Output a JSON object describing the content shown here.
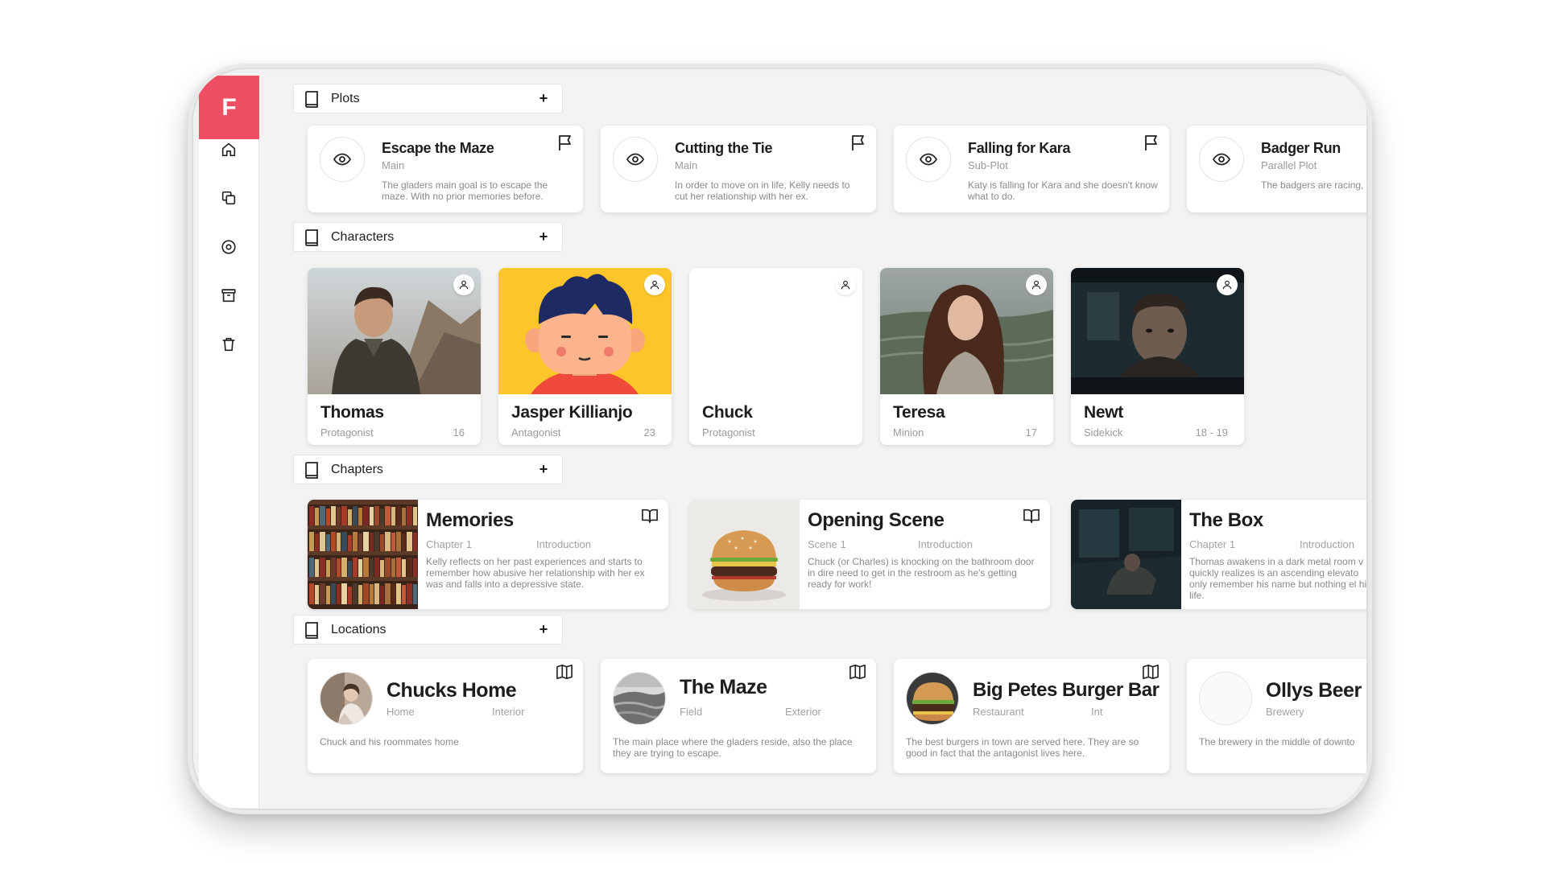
{
  "app": {
    "logo_letter": "F",
    "brand_color": "#ee4f62"
  },
  "sidebar": {
    "items": [
      {
        "icon": "home-icon"
      },
      {
        "icon": "copy-icon"
      },
      {
        "icon": "target-icon"
      },
      {
        "icon": "archive-icon"
      },
      {
        "icon": "trash-icon"
      }
    ]
  },
  "sections": {
    "plots": {
      "title": "Plots",
      "add_label": "+"
    },
    "characters": {
      "title": "Characters",
      "add_label": "+"
    },
    "chapters": {
      "title": "Chapters",
      "add_label": "+"
    },
    "locations": {
      "title": "Locations",
      "add_label": "+"
    }
  },
  "plots": [
    {
      "name": "Escape the Maze",
      "type": "Main",
      "desc": "The gladers main goal is to escape the maze. With no prior memories before."
    },
    {
      "name": "Cutting the Tie",
      "type": "Main",
      "desc": "In order to move on in life, Kelly needs to cut her relationship with her ex."
    },
    {
      "name": "Falling for Kara",
      "type": "Sub-Plot",
      "desc": "Katy is falling for Kara and she doesn't know what to do."
    },
    {
      "name": "Badger Run",
      "type": "Parallel Plot",
      "desc": "The badgers are racing, time that they bunnies a"
    }
  ],
  "characters": [
    {
      "name": "Thomas",
      "role": "Protagonist",
      "age": "16"
    },
    {
      "name": "Jasper Killianjo",
      "role": "Antagonist",
      "age": "23"
    },
    {
      "name": "Chuck",
      "role": "Protagonist",
      "age": ""
    },
    {
      "name": "Teresa",
      "role": "Minion",
      "age": "17"
    },
    {
      "name": "Newt",
      "role": "Sidekick",
      "age": "18 - 19"
    }
  ],
  "chapters": [
    {
      "name": "Memories",
      "num": "Chapter 1",
      "kind": "Introduction",
      "desc": "Kelly reflects on her past experiences and starts to remember how abusive her relationship with her ex was and falls into a depressive state."
    },
    {
      "name": "Opening Scene",
      "num": "Scene 1",
      "kind": "Introduction",
      "desc": "Chuck (or Charles) is knocking on the bathroom door in dire need to get in the restroom as he's getting ready for work!"
    },
    {
      "name": "The Box",
      "num": "Chapter 1",
      "kind": "Introduction",
      "desc": "Thomas awakens in a dark metal room v quickly realizes is an ascending elevato only remember his name but nothing el his life."
    }
  ],
  "locations": [
    {
      "name": "Chucks Home",
      "kind": "Home",
      "sub": "Interior",
      "desc": "Chuck and his roommates home"
    },
    {
      "name": "The Maze",
      "kind": "Field",
      "sub": "Exterior",
      "desc": "The main place where the gladers reside, also the place they are trying to escape."
    },
    {
      "name": "Big Petes Burger Bar",
      "kind": "Restaurant",
      "sub": "Int",
      "desc": "The best burgers in town are served here. They are so good in fact that the antagonist lives here."
    },
    {
      "name": "Ollys Beer",
      "kind": "Brewery",
      "sub": "",
      "desc": "The brewery in the middle of downto"
    }
  ]
}
